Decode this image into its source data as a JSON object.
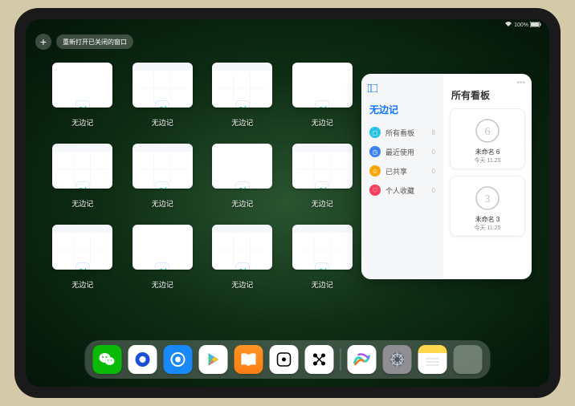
{
  "status": {
    "battery": "100%"
  },
  "top": {
    "plus": "+",
    "reopen": "重新打开已关闭的窗口"
  },
  "windows": [
    {
      "label": "无边记",
      "thumb": "blank"
    },
    {
      "label": "无边记",
      "thumb": "calendar"
    },
    {
      "label": "无边记",
      "thumb": "calendar"
    },
    {
      "label": "无边记",
      "thumb": "blank"
    },
    {
      "label": "无边记",
      "thumb": "calendar"
    },
    {
      "label": "无边记",
      "thumb": "calendar"
    },
    {
      "label": "无边记",
      "thumb": "blank"
    },
    {
      "label": "无边记",
      "thumb": "calendar"
    },
    {
      "label": "无边记",
      "thumb": "calendar"
    },
    {
      "label": "无边记",
      "thumb": "blank"
    },
    {
      "label": "无边记",
      "thumb": "calendar"
    },
    {
      "label": "无边记",
      "thumb": "calendar"
    }
  ],
  "sidepanel": {
    "left_title": "无边记",
    "categories": [
      {
        "icon_color": "#29c0e6",
        "glyph": "◻",
        "label": "所有看板",
        "count": "8"
      },
      {
        "icon_color": "#3b82f6",
        "glyph": "◷",
        "label": "最近使用",
        "count": "0"
      },
      {
        "icon_color": "#f6a609",
        "glyph": "☺",
        "label": "已共享",
        "count": "0"
      },
      {
        "icon_color": "#f43f5e",
        "glyph": "♡",
        "label": "个人收藏",
        "count": "0"
      }
    ],
    "right_title": "所有看板",
    "boards": [
      {
        "sketch": "6",
        "name": "未命名 6",
        "time": "今天 11:25"
      },
      {
        "sketch": "3",
        "name": "未命名 3",
        "time": "今天 11:25"
      }
    ]
  },
  "dock": {
    "items": [
      {
        "name": "wechat-icon"
      },
      {
        "name": "browser-icon"
      },
      {
        "name": "qq-browser-icon"
      },
      {
        "name": "play-store-icon"
      },
      {
        "name": "books-icon"
      },
      {
        "name": "game-icon"
      },
      {
        "name": "graph-icon"
      },
      {
        "name": "freeform-icon"
      },
      {
        "name": "settings-icon"
      },
      {
        "name": "notes-icon"
      },
      {
        "name": "app-group-icon"
      }
    ]
  }
}
